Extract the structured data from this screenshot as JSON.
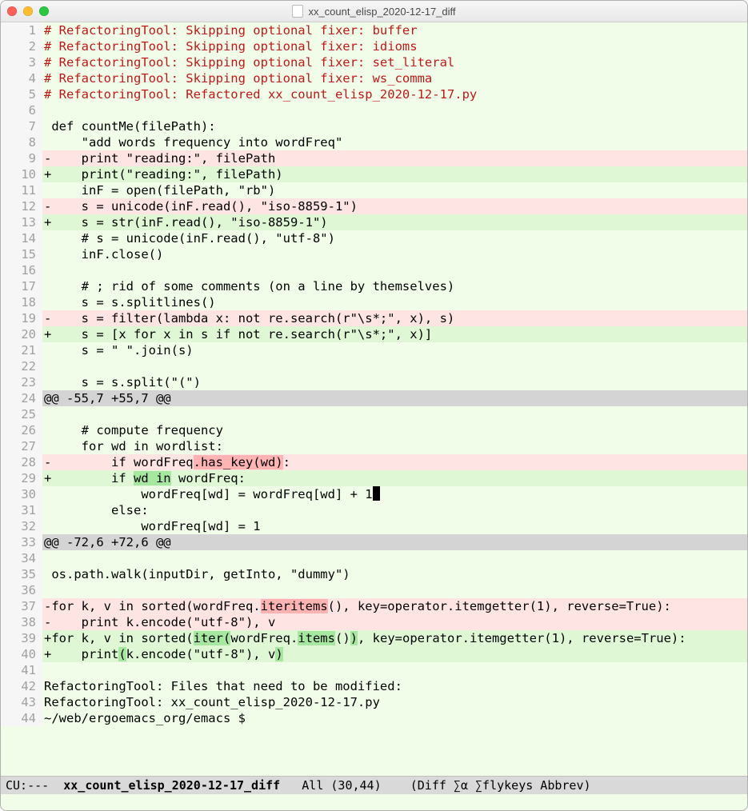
{
  "window": {
    "title": "xx_count_elisp_2020-12-17_diff"
  },
  "modeline": {
    "left": "CU:---  ",
    "buffer_name": "xx_count_elisp_2020-12-17_diff",
    "position": "   All (30,44)    ",
    "modes": "(Diff ∑α ∑flykeys Abbrev)"
  },
  "lines": [
    {
      "n": 1,
      "kind": "comment",
      "text": "# RefactoringTool: Skipping optional fixer: buffer"
    },
    {
      "n": 2,
      "kind": "comment",
      "text": "# RefactoringTool: Skipping optional fixer: idioms"
    },
    {
      "n": 3,
      "kind": "comment",
      "text": "# RefactoringTool: Skipping optional fixer: set_literal"
    },
    {
      "n": 4,
      "kind": "comment",
      "text": "# RefactoringTool: Skipping optional fixer: ws_comma"
    },
    {
      "n": 5,
      "kind": "comment",
      "text": "# RefactoringTool: Refactored xx_count_elisp_2020-12-17.py"
    },
    {
      "n": 6,
      "kind": "ctx",
      "text": ""
    },
    {
      "n": 7,
      "kind": "ctx",
      "text": " def countMe(filePath):"
    },
    {
      "n": 8,
      "kind": "ctx",
      "text": "     \"add words frequency into wordFreq\""
    },
    {
      "n": 9,
      "kind": "del",
      "text": "-    print \"reading:\", filePath"
    },
    {
      "n": 10,
      "kind": "add",
      "text": "+    print(\"reading:\", filePath)"
    },
    {
      "n": 11,
      "kind": "ctx",
      "text": "     inF = open(filePath, \"rb\")"
    },
    {
      "n": 12,
      "kind": "del",
      "text": "-    s = unicode(inF.read(), \"iso-8859-1\")"
    },
    {
      "n": 13,
      "kind": "add",
      "text": "+    s = str(inF.read(), \"iso-8859-1\")"
    },
    {
      "n": 14,
      "kind": "ctx",
      "text": "     # s = unicode(inF.read(), \"utf-8\")"
    },
    {
      "n": 15,
      "kind": "ctx",
      "text": "     inF.close()"
    },
    {
      "n": 16,
      "kind": "ctx",
      "text": ""
    },
    {
      "n": 17,
      "kind": "ctx",
      "text": "     # ; rid of some comments (on a line by themselves)"
    },
    {
      "n": 18,
      "kind": "ctx",
      "text": "     s = s.splitlines()"
    },
    {
      "n": 19,
      "kind": "del",
      "text": "-    s = filter(lambda x: not re.search(r\"\\s*;\", x), s)"
    },
    {
      "n": 20,
      "kind": "add",
      "text": "+    s = [x for x in s if not re.search(r\"\\s*;\", x)]"
    },
    {
      "n": 21,
      "kind": "ctx",
      "text": "     s = \" \".join(s)"
    },
    {
      "n": 22,
      "kind": "ctx",
      "text": ""
    },
    {
      "n": 23,
      "kind": "ctx",
      "text": "     s = s.split(\"(\")"
    },
    {
      "n": 24,
      "kind": "hunk",
      "text": "@@ -55,7 +55,7 @@"
    },
    {
      "n": 25,
      "kind": "ctx",
      "text": ""
    },
    {
      "n": 26,
      "kind": "ctx",
      "text": "     # compute frequency"
    },
    {
      "n": 27,
      "kind": "ctx",
      "text": "     for wd in wordlist:"
    },
    {
      "n": 28,
      "kind": "del",
      "spans": [
        {
          "t": "-        if wordFreq"
        },
        {
          "t": ".has_key(wd)",
          "cls": "refine-del"
        },
        {
          "t": ":"
        }
      ]
    },
    {
      "n": 29,
      "kind": "add",
      "spans": [
        {
          "t": "+        if "
        },
        {
          "t": "wd in",
          "cls": "refine-add"
        },
        {
          "t": " wordFreq:"
        }
      ]
    },
    {
      "n": 30,
      "kind": "ctx",
      "cursor_after": true,
      "text": "             wordFreq[wd] = wordFreq[wd] + 1"
    },
    {
      "n": 31,
      "kind": "ctx",
      "text": "         else:"
    },
    {
      "n": 32,
      "kind": "ctx",
      "text": "             wordFreq[wd] = 1"
    },
    {
      "n": 33,
      "kind": "hunk",
      "text": "@@ -72,6 +72,6 @@"
    },
    {
      "n": 34,
      "kind": "ctx",
      "text": ""
    },
    {
      "n": 35,
      "kind": "ctx",
      "text": " os.path.walk(inputDir, getInto, \"dummy\")"
    },
    {
      "n": 36,
      "kind": "ctx",
      "text": ""
    },
    {
      "n": 37,
      "kind": "del",
      "spans": [
        {
          "t": "-for k, v in sorted(wordFreq."
        },
        {
          "t": "iteritems",
          "cls": "refine-del"
        },
        {
          "t": "(), key=operator.itemgetter(1), reverse=True):"
        }
      ]
    },
    {
      "n": 38,
      "kind": "del",
      "text": "-    print k.encode(\"utf-8\"), v"
    },
    {
      "n": 39,
      "kind": "add",
      "spans": [
        {
          "t": "+for k, v in sorted("
        },
        {
          "t": "iter(",
          "cls": "refine-add"
        },
        {
          "t": "wordFreq."
        },
        {
          "t": "items",
          "cls": "refine-add"
        },
        {
          "t": "()"
        },
        {
          "t": ")",
          "cls": "refine-add"
        },
        {
          "t": ", key=operator.itemgetter(1), reverse=True):"
        }
      ]
    },
    {
      "n": 40,
      "kind": "add",
      "spans": [
        {
          "t": "+    print"
        },
        {
          "t": "(",
          "cls": "refine-add"
        },
        {
          "t": "k.encode(\"utf-8\"), v"
        },
        {
          "t": ")",
          "cls": "refine-add"
        }
      ]
    },
    {
      "n": 41,
      "kind": "ctx",
      "text": ""
    },
    {
      "n": 42,
      "kind": "ctx",
      "text": "RefactoringTool: Files that need to be modified:"
    },
    {
      "n": 43,
      "kind": "ctx",
      "text": "RefactoringTool: xx_count_elisp_2020-12-17.py"
    },
    {
      "n": 44,
      "kind": "ctx",
      "text": "~/web/ergoemacs_org/emacs $"
    }
  ]
}
